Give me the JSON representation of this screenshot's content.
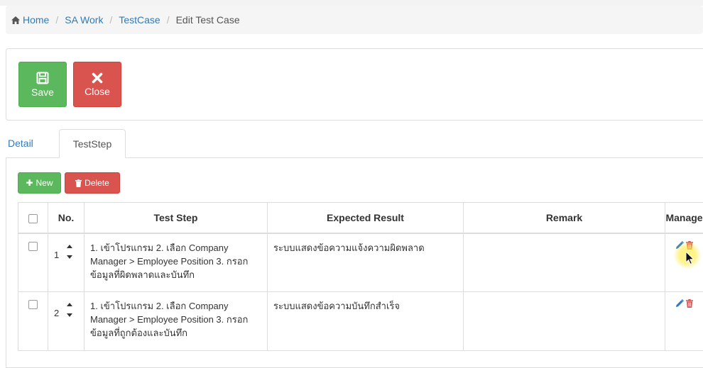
{
  "breadcrumb": {
    "items": [
      "Home",
      "SA Work",
      "TestCase"
    ],
    "current": "Edit Test Case"
  },
  "toolbar": {
    "save_label": "Save",
    "close_label": "Close"
  },
  "tabs": [
    {
      "label": "Detail",
      "active": false
    },
    {
      "label": "TestStep",
      "active": true
    }
  ],
  "actions": {
    "new_label": "New",
    "delete_label": "Delete"
  },
  "table": {
    "headers": [
      "No.",
      "Test Step",
      "Expected Result",
      "Remark",
      "Manage"
    ],
    "rows": [
      {
        "no": "1",
        "test_step": "1. เข้าโปรแกรม 2. เลือก Company Manager > Employee Position 3. กรอกข้อมูลที่ผิดพลาดและบันทึก",
        "expected_result": "ระบบแสดงข้อความแจ้งความผิดพลาด",
        "remark": ""
      },
      {
        "no": "2",
        "test_step": "1. เข้าโปรแกรม 2. เลือก Company Manager > Employee Position 3. กรอกข้อมูลที่ถูกต้องและบันทึก",
        "expected_result": "ระบบแสดงข้อความบันทึกสำเร็จ",
        "remark": ""
      }
    ]
  },
  "colors": {
    "success": "#5cb85c",
    "danger": "#d9534f",
    "link": "#337ab7"
  },
  "icons": [
    "home-icon",
    "save-icon",
    "close-icon",
    "plus-icon",
    "trash-icon",
    "pencil-icon",
    "sort-up-icon",
    "sort-down-icon"
  ]
}
